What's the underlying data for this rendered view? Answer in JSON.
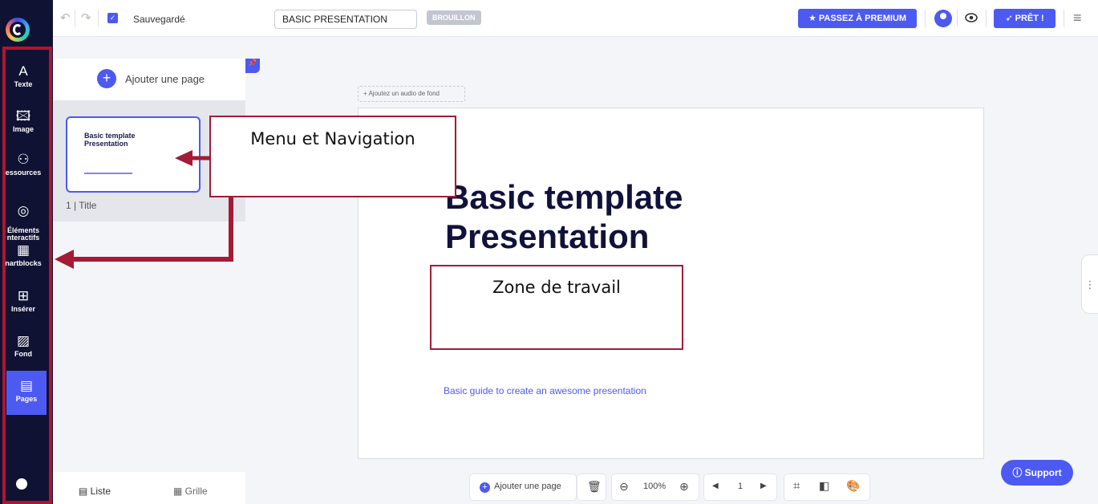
{
  "sidebar": {
    "items": [
      {
        "label": "Texte",
        "icon": "text-icon",
        "glyph": "A"
      },
      {
        "label": "Image",
        "icon": "image-icon",
        "glyph": "🖾"
      },
      {
        "label": "essources",
        "icon": "resources-icon",
        "glyph": "⚇"
      },
      {
        "label": "Éléments\nnteractifs",
        "icon": "interactive-icon",
        "glyph": "◎"
      },
      {
        "label": "nartblocks",
        "icon": "smartblocks-icon",
        "glyph": "▦"
      },
      {
        "label": "Insérer",
        "icon": "insert-icon",
        "glyph": "⊞"
      },
      {
        "label": "Fond",
        "icon": "background-icon",
        "glyph": "▨"
      },
      {
        "label": "Pages",
        "icon": "pages-icon",
        "glyph": "▤"
      }
    ],
    "active": "Pages"
  },
  "topbar": {
    "saved_label": "Sauvegardé",
    "title_value": "BASIC PRESENTATION",
    "draft_badge": "BROUILLON",
    "premium_button": "PASSEZ À PREMIUM",
    "ready_button": "PRÊT !"
  },
  "panel": {
    "add_page_label": "Ajouter une page",
    "thumbnail_title": "Basic template Presentation",
    "page_label": "1 | Title",
    "tab_list": "Liste",
    "tab_grid": "Grille"
  },
  "canvas": {
    "audio_label": "Ajoutez un audio de fond",
    "slide_title": "Basic template Presentation",
    "slide_subtitle": "Basic guide to create an awesome presentation"
  },
  "bottombar": {
    "add_page_label": "Ajouter une page",
    "zoom_value": "100%",
    "page_number": "1"
  },
  "support_label": "Support",
  "annotations": {
    "menu_label": "Menu et Navigation",
    "work_label": "Zone de travail"
  },
  "colors": {
    "accent": "#4c5af2",
    "sidebar_bg": "#0f1233",
    "annotation": "#a31b36"
  }
}
